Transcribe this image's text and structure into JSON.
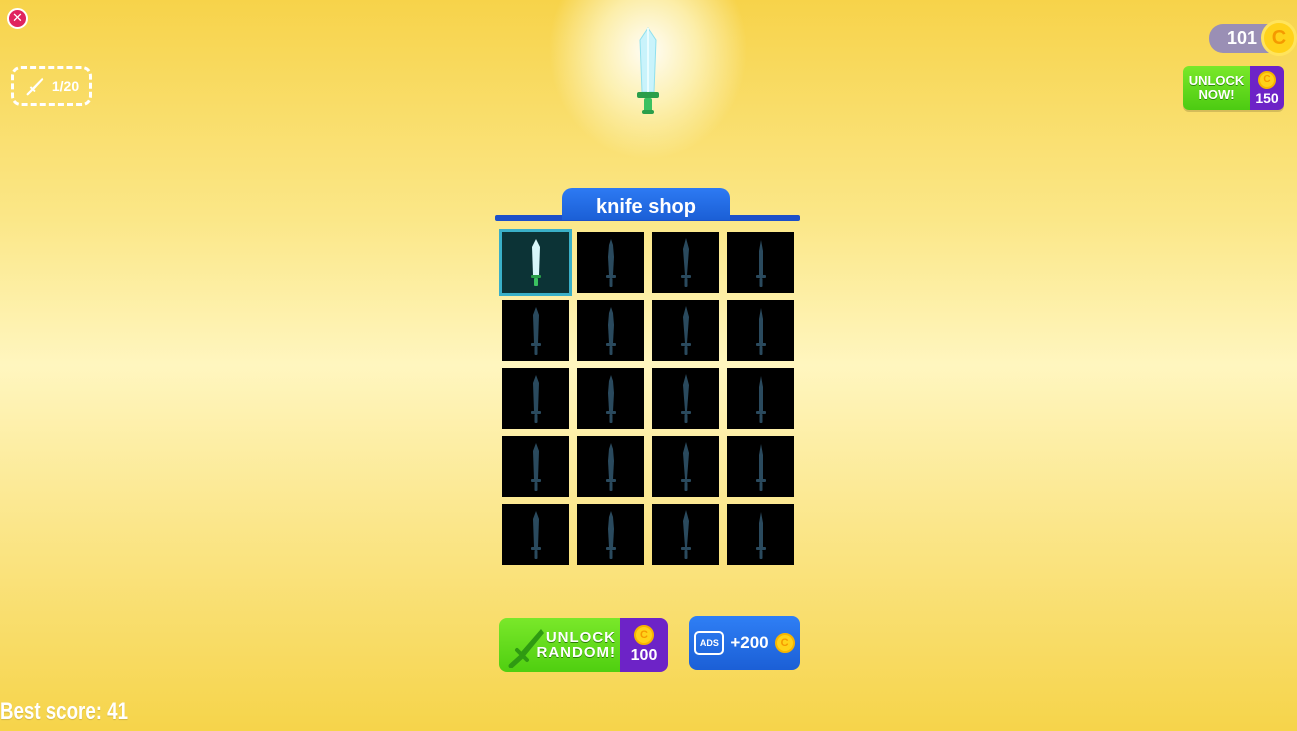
{
  "top": {
    "close_icon": "close-icon",
    "collection_counter": "1/20",
    "coins": "101",
    "unlock_now": {
      "line1": "UNLOCK",
      "line2": "NOW!",
      "price": "150"
    }
  },
  "shop": {
    "title": "knife shop",
    "selected_index": 0,
    "knives": [
      {
        "state": "unlocked",
        "icon": "ice-sword-icon"
      },
      {
        "state": "locked",
        "icon": "locked-knife-silhouette"
      },
      {
        "state": "locked",
        "icon": "locked-knife-silhouette"
      },
      {
        "state": "locked",
        "icon": "locked-knife-silhouette"
      },
      {
        "state": "locked",
        "icon": "locked-knife-silhouette"
      },
      {
        "state": "locked",
        "icon": "locked-knife-silhouette"
      },
      {
        "state": "locked",
        "icon": "locked-knife-silhouette"
      },
      {
        "state": "locked",
        "icon": "locked-knife-silhouette"
      },
      {
        "state": "locked",
        "icon": "locked-knife-silhouette"
      },
      {
        "state": "locked",
        "icon": "locked-knife-silhouette"
      },
      {
        "state": "locked",
        "icon": "locked-knife-silhouette"
      },
      {
        "state": "locked",
        "icon": "locked-knife-silhouette"
      },
      {
        "state": "locked",
        "icon": "locked-knife-silhouette"
      },
      {
        "state": "locked",
        "icon": "locked-knife-silhouette"
      },
      {
        "state": "locked",
        "icon": "locked-knife-silhouette"
      },
      {
        "state": "locked",
        "icon": "locked-knife-silhouette"
      },
      {
        "state": "locked",
        "icon": "locked-knife-silhouette"
      },
      {
        "state": "locked",
        "icon": "locked-knife-silhouette"
      },
      {
        "state": "locked",
        "icon": "locked-knife-silhouette"
      },
      {
        "state": "locked",
        "icon": "locked-knife-silhouette"
      }
    ]
  },
  "buttons": {
    "unlock_random": {
      "line1": "UNLOCK",
      "line2": "RANDOM!",
      "price": "100"
    },
    "ads": {
      "icon_label": "ADS",
      "reward": "+200"
    }
  },
  "best_score": "Best score: 41",
  "colors": {
    "background": "#f7d34a",
    "shop_blue": "#1b5fd6",
    "unlock_green": "#5ad516",
    "price_purple": "#6d23c7",
    "coin_gold": "#ffd21a",
    "locked_silhouette": "#2a4a5e"
  }
}
